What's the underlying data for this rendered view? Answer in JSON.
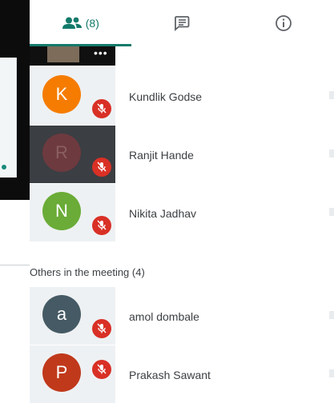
{
  "tabs": {
    "people_count": "(8)",
    "people_icon": "people-icon",
    "chat_icon": "chat-icon",
    "info_icon": "info-icon",
    "accent": "#137a6a"
  },
  "top_tile": {
    "more_label": "•••"
  },
  "in_call": [
    {
      "initial": "K",
      "name": "Kundlik Godse",
      "color": "#f57c00",
      "muted": true
    },
    {
      "initial": "R",
      "name": "Ranjit Hande",
      "color": "#6d3a3f",
      "muted": true
    },
    {
      "initial": "N",
      "name": "Nikita Jadhav",
      "color": "#6aac37",
      "muted": true
    }
  ],
  "others": {
    "label": "Others in the meeting (4)",
    "participants": [
      {
        "initial": "a",
        "name": "amol dombale",
        "color": "#455a64",
        "muted": true
      },
      {
        "initial": "P",
        "name": "Prakash Sawant",
        "color": "#c0391b",
        "muted": true
      }
    ]
  },
  "mute_color": "#d93025"
}
